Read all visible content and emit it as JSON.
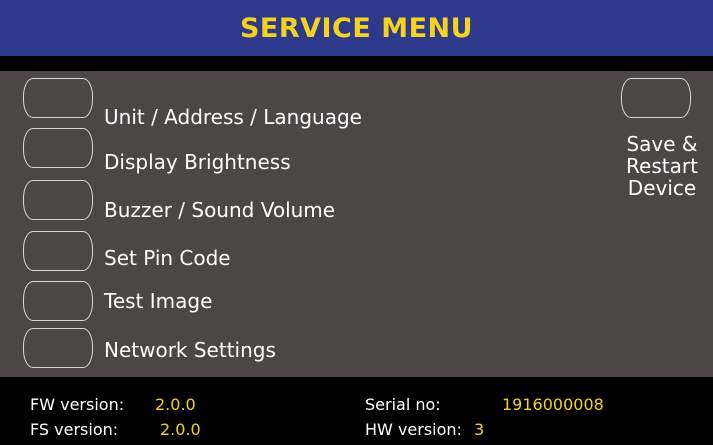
{
  "header": {
    "title": "SERVICE MENU"
  },
  "menu": {
    "items": [
      {
        "label": "Unit / Address / Language"
      },
      {
        "label": "Display Brightness"
      },
      {
        "label": "Buzzer / Sound Volume"
      },
      {
        "label": "Set Pin Code"
      },
      {
        "label": "Test Image"
      },
      {
        "label": "Network Settings"
      }
    ],
    "save": {
      "line1": "Save &",
      "line2": "Restart",
      "line3": "Device"
    }
  },
  "footer": {
    "fw_label": "FW version:",
    "fw_value": "2.0.0",
    "fs_label": "FS version:",
    "fs_value": "2.0.0",
    "serial_label": "Serial no:",
    "serial_value": "1916000008",
    "hw_label": "HW version:",
    "hw_value": "3"
  },
  "colors": {
    "header_bg": "#2d3a8c",
    "accent_yellow": "#f5d21e",
    "panel_bg": "#4a4746",
    "background": "#000000"
  }
}
